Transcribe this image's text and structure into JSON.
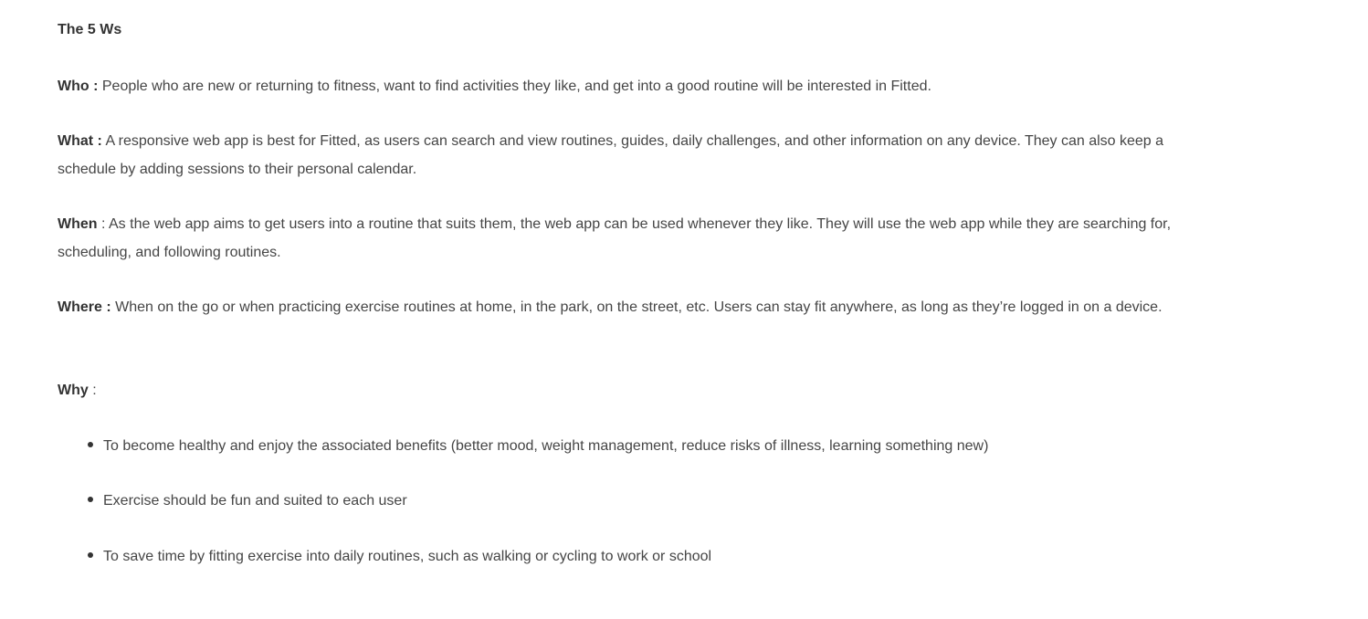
{
  "heading": "The 5 Ws",
  "who": {
    "term": "Who :",
    "text": " People who are new or returning to fitness, want to find activities they like, and get into a good routine will be interested in Fitted."
  },
  "what": {
    "term": "What :",
    "text": " A responsive web app is best for Fitted, as users can search and view routines, guides, daily challenges, and other information on any device. They can also keep a schedule by adding sessions to their personal calendar."
  },
  "when": {
    "term": "When",
    "text": " : As the web app aims to get users into a routine that suits them, the web app can be used whenever they like. They will use the web app while they are searching for, scheduling, and following routines."
  },
  "where": {
    "term": "Where :",
    "text": " When on the go or when practicing exercise routines at home, in the park, on the street, etc. Users can stay fit anywhere, as long as they’re logged in on a device."
  },
  "why": {
    "term": "Why",
    "text": " :",
    "reasons": [
      "To become healthy and enjoy the associated benefits (better mood, weight management, reduce risks of illness, learning something new)",
      "Exercise should be fun and suited to each user",
      "To save time by fitting exercise into daily routines, such as walking or cycling to work or school"
    ]
  },
  "colors": {
    "body_text": "#454545",
    "bold_text": "#333333",
    "background": "#ffffff"
  }
}
